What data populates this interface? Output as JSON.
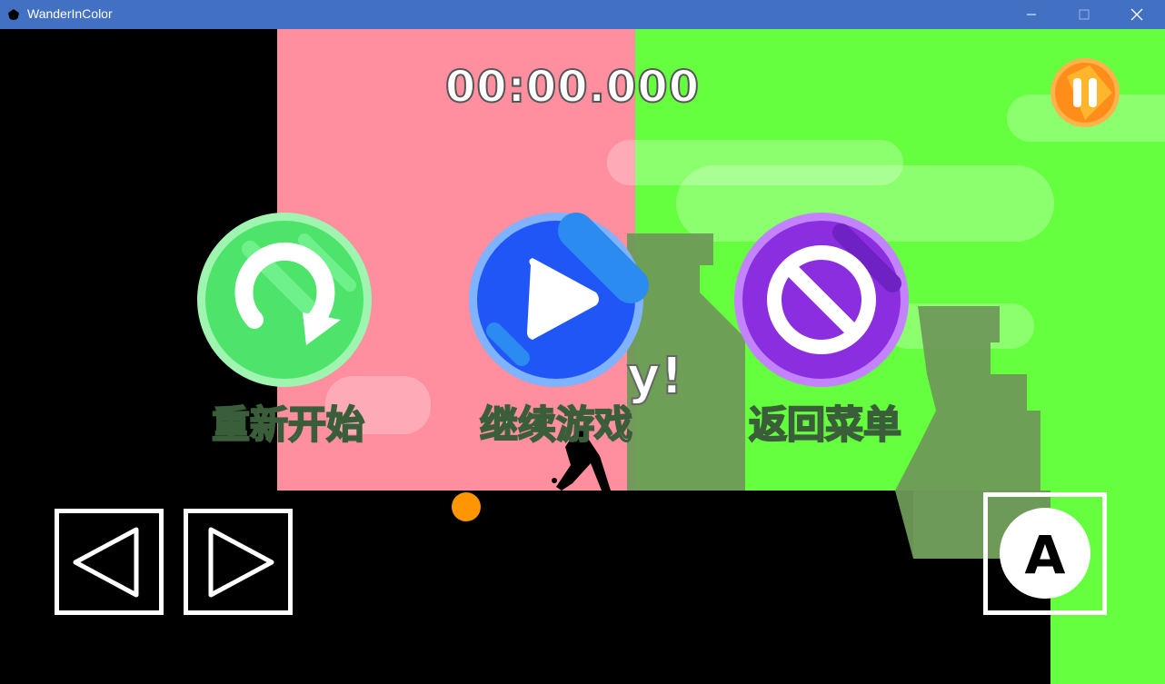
{
  "window": {
    "title": "WanderInColor",
    "minimize_glyph": "—",
    "maximize_glyph": "☐",
    "close_glyph": "✕"
  },
  "hud": {
    "timer": "00:00.000",
    "pause_icon": "pause-icon"
  },
  "background_text": {
    "partial": "y!"
  },
  "pause_menu": {
    "restart_label": "重新开始",
    "continue_label": "继续游戏",
    "menu_label": "返回菜单"
  },
  "controls": {
    "left_icon": "triangle-left-icon",
    "right_icon": "triangle-right-icon",
    "a_label": "A"
  },
  "colors": {
    "pink": "#ff8e9f",
    "green": "#66ff3f",
    "restart": "#4ee36a",
    "continue": "#1f56f5",
    "menu": "#8a2ee0",
    "pause": "#ff9a22",
    "orange_dot": "#ff9500"
  }
}
